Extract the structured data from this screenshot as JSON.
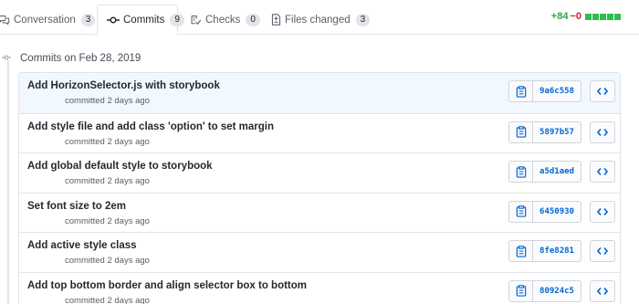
{
  "tabs": [
    {
      "label": "Conversation",
      "count": "3",
      "icon": "comment-discussion-icon"
    },
    {
      "label": "Commits",
      "count": "9",
      "icon": "git-commit-icon"
    },
    {
      "label": "Checks",
      "count": "0",
      "icon": "checklist-icon"
    },
    {
      "label": "Files changed",
      "count": "3",
      "icon": "file-diff-icon"
    }
  ],
  "active_tab": "Commits",
  "diffstat": {
    "additions": "+84",
    "deletions": "−0",
    "blocks": 5,
    "block_color": "#2cbe4e"
  },
  "group_title": "Commits on Feb 28, 2019",
  "commits": [
    {
      "message": "Add HorizonSelector.js with storybook",
      "meta": "committed 2 days ago",
      "sha": "9a6c558"
    },
    {
      "message": "Add style file and add class 'option' to set margin",
      "meta": "committed 2 days ago",
      "sha": "5897b57"
    },
    {
      "message": "Add global default style to storybook",
      "meta": "committed 2 days ago",
      "sha": "a5d1aed"
    },
    {
      "message": "Set font size to 2em",
      "meta": "committed 2 days ago",
      "sha": "6450930"
    },
    {
      "message": "Add active style class",
      "meta": "committed 2 days ago",
      "sha": "8fe8281"
    },
    {
      "message": "Add top bottom border and align selector box to bottom",
      "meta": "committed 2 days ago",
      "sha": "80924c5"
    }
  ],
  "colors": {
    "link": "#0366d6",
    "addition": "#28a745",
    "deletion": "#cb2431",
    "highlight_row": "#f1f8ff"
  }
}
